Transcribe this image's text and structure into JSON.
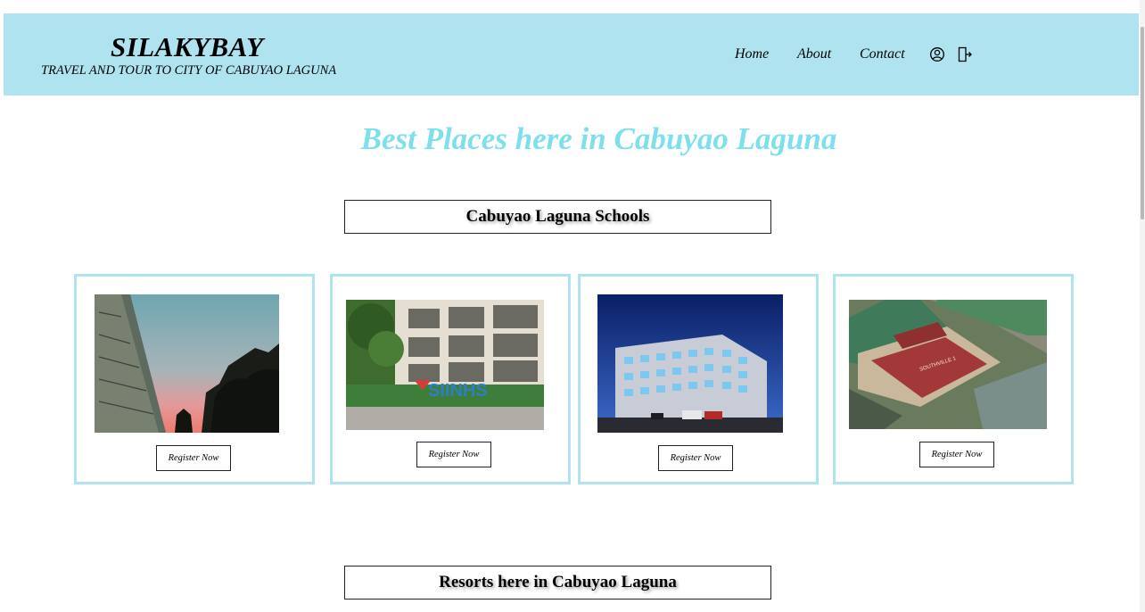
{
  "brand": {
    "title": "SILAKYBAY",
    "tagline": "TRAVEL AND TOUR TO CITY OF CABUYAO LAGUNA"
  },
  "nav": {
    "items": [
      {
        "label": "Home"
      },
      {
        "label": "About"
      },
      {
        "label": "Contact"
      }
    ],
    "icons": [
      "user-circle-icon",
      "logout-icon"
    ]
  },
  "main": {
    "heading": "Best Places here in Cabuyao Laguna",
    "sections": [
      {
        "title": "Cabuyao Laguna Schools"
      },
      {
        "title": "Resorts here in Cabuyao Laguna"
      }
    ],
    "schools": [
      {
        "photo": "school-building-at-sunset",
        "button": "Register Now"
      },
      {
        "photo": "school-with-sinhs-sign",
        "button": "Register Now"
      },
      {
        "photo": "school-building-at-night",
        "button": "Register Now"
      },
      {
        "photo": "aerial-school-campus",
        "button": "Register Now"
      }
    ]
  },
  "colors": {
    "header_bg": "#aee3ef",
    "heading": "#7ee0ec",
    "card_border": "#aee3ef"
  }
}
